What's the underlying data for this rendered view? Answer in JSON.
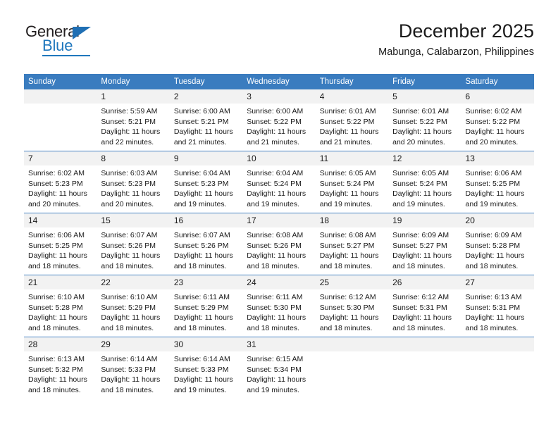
{
  "logo": {
    "word_top": "General",
    "word_bottom": "Blue",
    "accent_color": "#1f77bd",
    "triangle_icon": "triangle-icon"
  },
  "header": {
    "title": "December 2025",
    "subtitle": "Mabunga, Calabarzon, Philippines"
  },
  "calendar": {
    "header_bg": "#3a7cbf",
    "daynum_bg": "#f2f2f2",
    "weekday_headers": [
      "Sunday",
      "Monday",
      "Tuesday",
      "Wednesday",
      "Thursday",
      "Friday",
      "Saturday"
    ],
    "weeks": [
      [
        {
          "day": "",
          "lines": []
        },
        {
          "day": "1",
          "lines": [
            "Sunrise: 5:59 AM",
            "Sunset: 5:21 PM",
            "Daylight: 11 hours",
            "and 22 minutes."
          ]
        },
        {
          "day": "2",
          "lines": [
            "Sunrise: 6:00 AM",
            "Sunset: 5:21 PM",
            "Daylight: 11 hours",
            "and 21 minutes."
          ]
        },
        {
          "day": "3",
          "lines": [
            "Sunrise: 6:00 AM",
            "Sunset: 5:22 PM",
            "Daylight: 11 hours",
            "and 21 minutes."
          ]
        },
        {
          "day": "4",
          "lines": [
            "Sunrise: 6:01 AM",
            "Sunset: 5:22 PM",
            "Daylight: 11 hours",
            "and 21 minutes."
          ]
        },
        {
          "day": "5",
          "lines": [
            "Sunrise: 6:01 AM",
            "Sunset: 5:22 PM",
            "Daylight: 11 hours",
            "and 20 minutes."
          ]
        },
        {
          "day": "6",
          "lines": [
            "Sunrise: 6:02 AM",
            "Sunset: 5:22 PM",
            "Daylight: 11 hours",
            "and 20 minutes."
          ]
        }
      ],
      [
        {
          "day": "7",
          "lines": [
            "Sunrise: 6:02 AM",
            "Sunset: 5:23 PM",
            "Daylight: 11 hours",
            "and 20 minutes."
          ]
        },
        {
          "day": "8",
          "lines": [
            "Sunrise: 6:03 AM",
            "Sunset: 5:23 PM",
            "Daylight: 11 hours",
            "and 20 minutes."
          ]
        },
        {
          "day": "9",
          "lines": [
            "Sunrise: 6:04 AM",
            "Sunset: 5:23 PM",
            "Daylight: 11 hours",
            "and 19 minutes."
          ]
        },
        {
          "day": "10",
          "lines": [
            "Sunrise: 6:04 AM",
            "Sunset: 5:24 PM",
            "Daylight: 11 hours",
            "and 19 minutes."
          ]
        },
        {
          "day": "11",
          "lines": [
            "Sunrise: 6:05 AM",
            "Sunset: 5:24 PM",
            "Daylight: 11 hours",
            "and 19 minutes."
          ]
        },
        {
          "day": "12",
          "lines": [
            "Sunrise: 6:05 AM",
            "Sunset: 5:24 PM",
            "Daylight: 11 hours",
            "and 19 minutes."
          ]
        },
        {
          "day": "13",
          "lines": [
            "Sunrise: 6:06 AM",
            "Sunset: 5:25 PM",
            "Daylight: 11 hours",
            "and 19 minutes."
          ]
        }
      ],
      [
        {
          "day": "14",
          "lines": [
            "Sunrise: 6:06 AM",
            "Sunset: 5:25 PM",
            "Daylight: 11 hours",
            "and 18 minutes."
          ]
        },
        {
          "day": "15",
          "lines": [
            "Sunrise: 6:07 AM",
            "Sunset: 5:26 PM",
            "Daylight: 11 hours",
            "and 18 minutes."
          ]
        },
        {
          "day": "16",
          "lines": [
            "Sunrise: 6:07 AM",
            "Sunset: 5:26 PM",
            "Daylight: 11 hours",
            "and 18 minutes."
          ]
        },
        {
          "day": "17",
          "lines": [
            "Sunrise: 6:08 AM",
            "Sunset: 5:26 PM",
            "Daylight: 11 hours",
            "and 18 minutes."
          ]
        },
        {
          "day": "18",
          "lines": [
            "Sunrise: 6:08 AM",
            "Sunset: 5:27 PM",
            "Daylight: 11 hours",
            "and 18 minutes."
          ]
        },
        {
          "day": "19",
          "lines": [
            "Sunrise: 6:09 AM",
            "Sunset: 5:27 PM",
            "Daylight: 11 hours",
            "and 18 minutes."
          ]
        },
        {
          "day": "20",
          "lines": [
            "Sunrise: 6:09 AM",
            "Sunset: 5:28 PM",
            "Daylight: 11 hours",
            "and 18 minutes."
          ]
        }
      ],
      [
        {
          "day": "21",
          "lines": [
            "Sunrise: 6:10 AM",
            "Sunset: 5:28 PM",
            "Daylight: 11 hours",
            "and 18 minutes."
          ]
        },
        {
          "day": "22",
          "lines": [
            "Sunrise: 6:10 AM",
            "Sunset: 5:29 PM",
            "Daylight: 11 hours",
            "and 18 minutes."
          ]
        },
        {
          "day": "23",
          "lines": [
            "Sunrise: 6:11 AM",
            "Sunset: 5:29 PM",
            "Daylight: 11 hours",
            "and 18 minutes."
          ]
        },
        {
          "day": "24",
          "lines": [
            "Sunrise: 6:11 AM",
            "Sunset: 5:30 PM",
            "Daylight: 11 hours",
            "and 18 minutes."
          ]
        },
        {
          "day": "25",
          "lines": [
            "Sunrise: 6:12 AM",
            "Sunset: 5:30 PM",
            "Daylight: 11 hours",
            "and 18 minutes."
          ]
        },
        {
          "day": "26",
          "lines": [
            "Sunrise: 6:12 AM",
            "Sunset: 5:31 PM",
            "Daylight: 11 hours",
            "and 18 minutes."
          ]
        },
        {
          "day": "27",
          "lines": [
            "Sunrise: 6:13 AM",
            "Sunset: 5:31 PM",
            "Daylight: 11 hours",
            "and 18 minutes."
          ]
        }
      ],
      [
        {
          "day": "28",
          "lines": [
            "Sunrise: 6:13 AM",
            "Sunset: 5:32 PM",
            "Daylight: 11 hours",
            "and 18 minutes."
          ]
        },
        {
          "day": "29",
          "lines": [
            "Sunrise: 6:14 AM",
            "Sunset: 5:33 PM",
            "Daylight: 11 hours",
            "and 18 minutes."
          ]
        },
        {
          "day": "30",
          "lines": [
            "Sunrise: 6:14 AM",
            "Sunset: 5:33 PM",
            "Daylight: 11 hours",
            "and 19 minutes."
          ]
        },
        {
          "day": "31",
          "lines": [
            "Sunrise: 6:15 AM",
            "Sunset: 5:34 PM",
            "Daylight: 11 hours",
            "and 19 minutes."
          ]
        },
        {
          "day": "",
          "lines": []
        },
        {
          "day": "",
          "lines": []
        },
        {
          "day": "",
          "lines": []
        }
      ]
    ]
  }
}
